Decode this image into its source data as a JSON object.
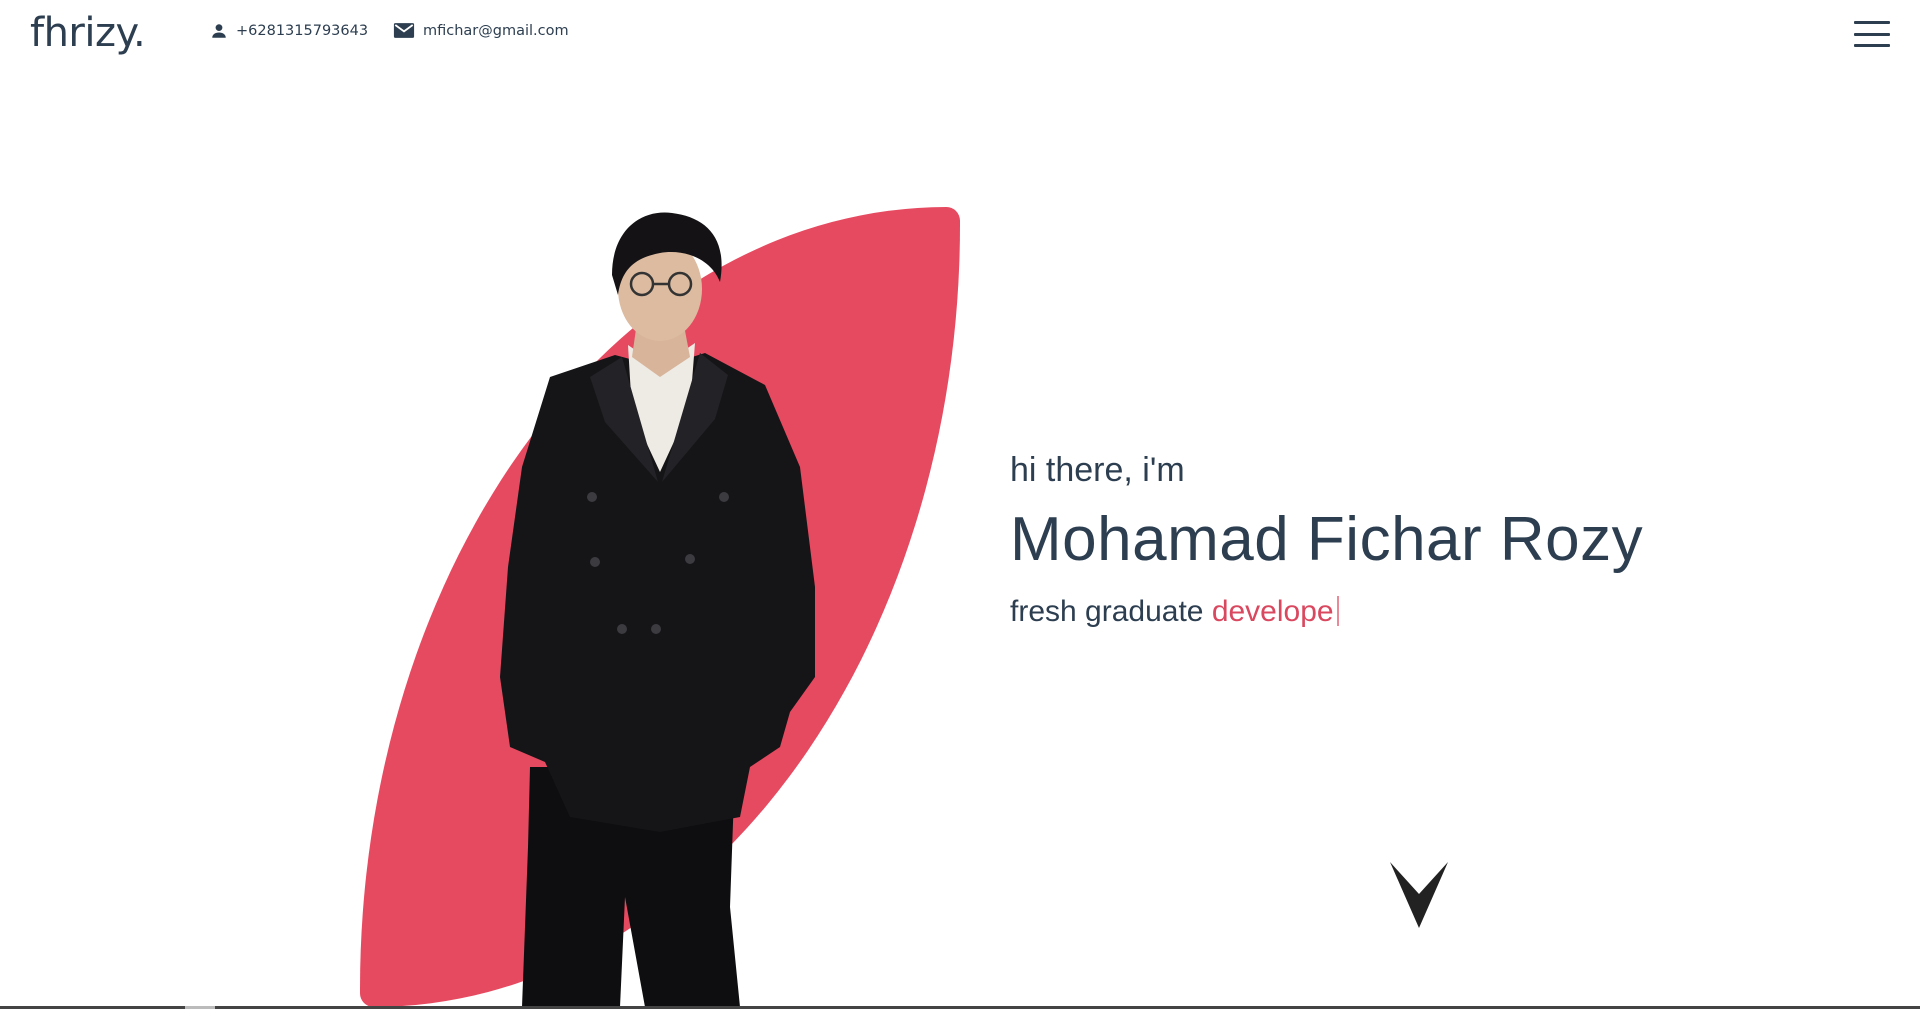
{
  "header": {
    "logo": "fhrizy.",
    "phone": "+6281315793643",
    "email": "mfichar@gmail.com",
    "phone_icon": "person-icon",
    "email_icon": "mail-icon",
    "menu_icon": "hamburger-menu-icon"
  },
  "hero": {
    "greeting": "hi there, i'm",
    "name": "Mohamad Fichar Rozy",
    "tagline_prefix": "fresh graduate",
    "tagline_typed": "develope",
    "accent_color": "#e64a60",
    "text_color": "#2c3e50",
    "scroll_icon": "chevron-down-icon"
  }
}
